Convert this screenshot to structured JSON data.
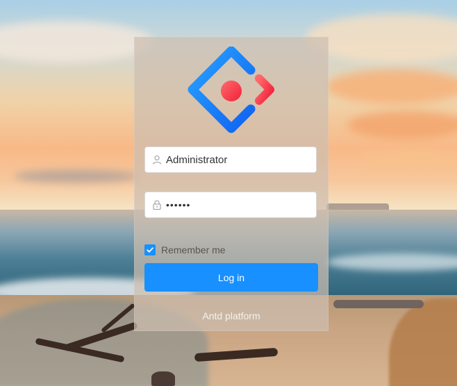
{
  "login": {
    "username_value": "Administrator",
    "password_value": "••••••",
    "remember_label": "Remember me",
    "remember_checked": true,
    "login_button": "Log in",
    "footer_text": "Antd platform"
  },
  "icons": {
    "logo": "antd-logo-icon",
    "username": "user-icon",
    "password": "lock-icon",
    "checkbox": "check-icon"
  },
  "colors": {
    "primary": "#1890ff",
    "logo_blue": "#1677ff",
    "logo_red": "#f5222d"
  }
}
